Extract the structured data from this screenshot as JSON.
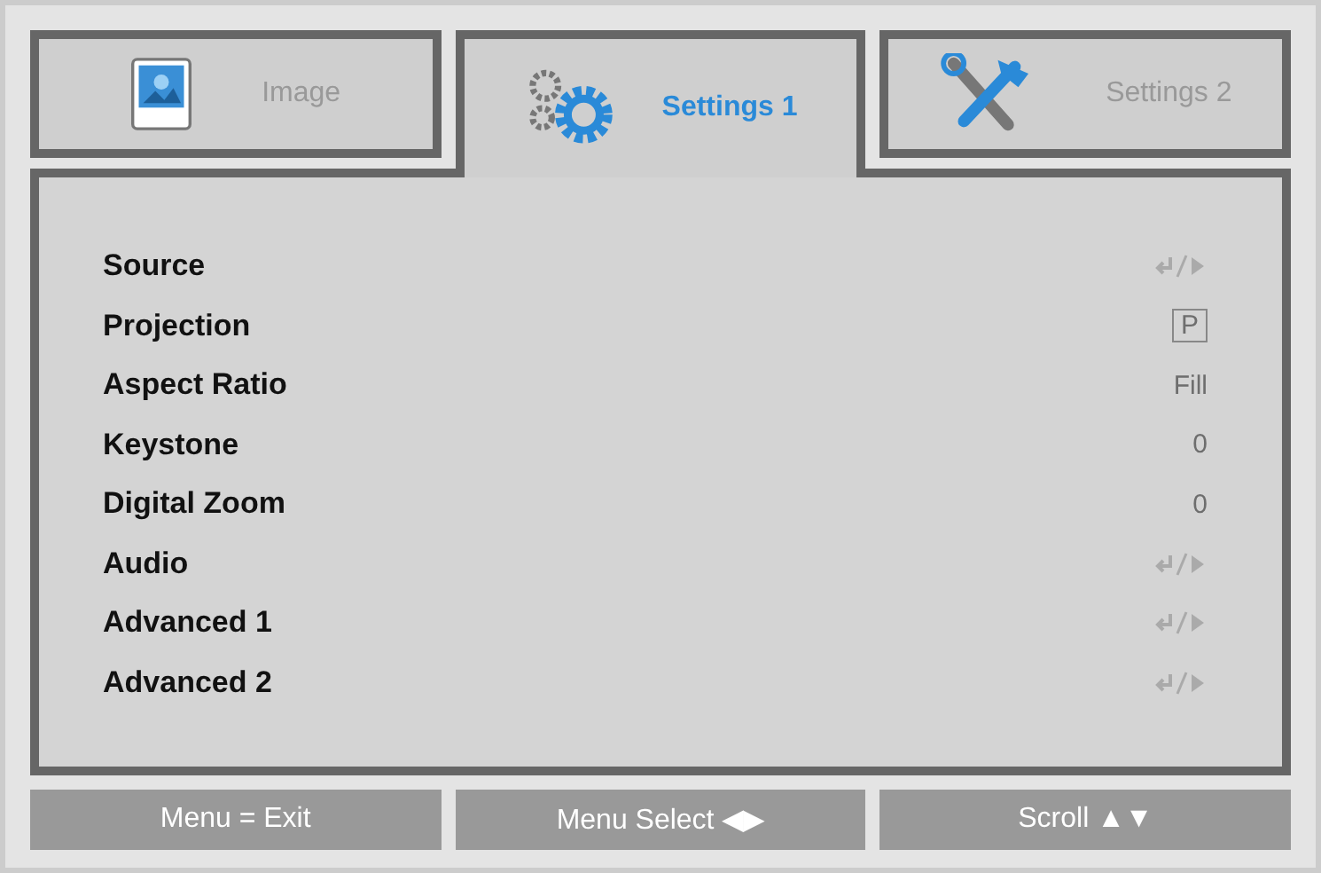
{
  "tabs": [
    {
      "label": "Image",
      "selected": false
    },
    {
      "label": "Settings 1",
      "selected": true
    },
    {
      "label": "Settings 2",
      "selected": false
    }
  ],
  "items": [
    {
      "label": "Source",
      "kind": "enter"
    },
    {
      "label": "Projection",
      "kind": "boxed",
      "value": "P"
    },
    {
      "label": "Aspect Ratio",
      "kind": "text",
      "value": "Fill"
    },
    {
      "label": "Keystone",
      "kind": "text",
      "value": "0"
    },
    {
      "label": "Digital Zoom",
      "kind": "text",
      "value": "0"
    },
    {
      "label": "Audio",
      "kind": "enter"
    },
    {
      "label": "Advanced 1",
      "kind": "enter"
    },
    {
      "label": "Advanced 2",
      "kind": "enter"
    }
  ],
  "footer": [
    "Menu = Exit",
    "Menu Select ◀▶",
    "Scroll ▲▼"
  ]
}
